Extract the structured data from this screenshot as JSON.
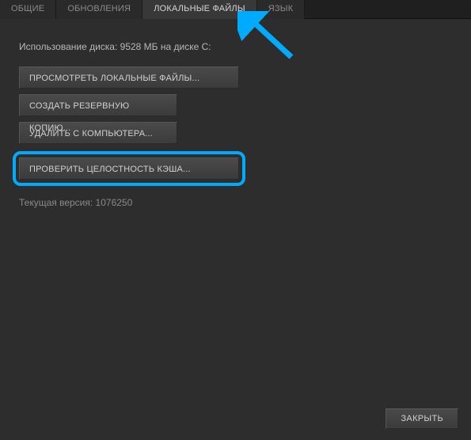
{
  "tabs": {
    "general": "ОБЩИЕ",
    "updates": "ОБНОВЛЕНИЯ",
    "local_files": "ЛОКАЛЬНЫЕ ФАЙЛЫ",
    "language": "ЯЗЫК"
  },
  "content": {
    "disk_usage": "Использование диска: 9528 МБ на диске C:",
    "browse_local": "ПРОСМОТРЕТЬ ЛОКАЛЬНЫЕ ФАЙЛЫ...",
    "backup": "СОЗДАТЬ РЕЗЕРВНУЮ КОПИЮ...",
    "delete": "УДАЛИТЬ С КОМПЬЮТЕРА...",
    "verify": "ПРОВЕРИТЬ ЦЕЛОСТНОСТЬ КЭША...",
    "version": "Текущая версия: 1076250"
  },
  "footer": {
    "close": "ЗАКРЫТЬ"
  }
}
